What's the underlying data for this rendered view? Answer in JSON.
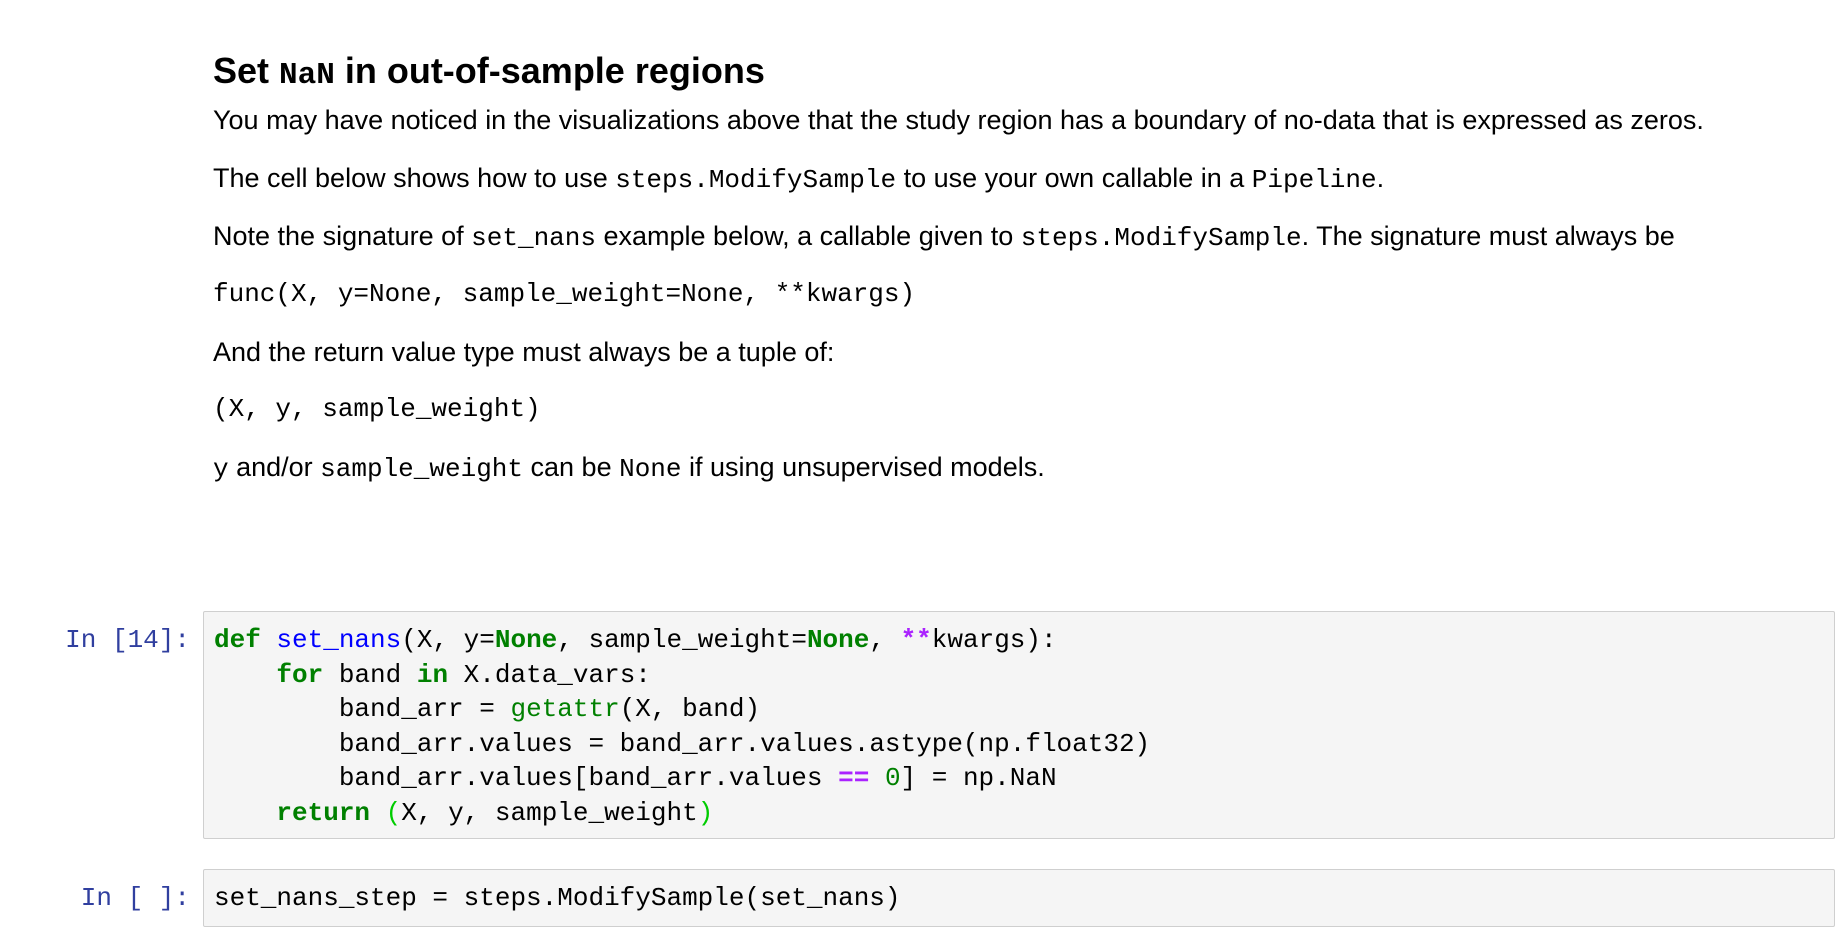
{
  "markdown": {
    "heading_pre": "Set ",
    "heading_code": "NaN",
    "heading_post": " in out-of-sample regions",
    "p1": "You may have noticed in the visualizations above that the study region has a boundary of no-data that is expressed as zeros.",
    "p2_a": "The cell below shows how to use ",
    "p2_code1": "steps.ModifySample",
    "p2_b": " to use your own callable in a ",
    "p2_code2": "Pipeline",
    "p2_c": ".",
    "p3_a": "Note the signature of ",
    "p3_code1": "set_nans",
    "p3_b": " example below, a callable given to ",
    "p3_code2": "steps.ModifySample",
    "p3_c": ". The signature must always be",
    "code_sig": "func(X, y=None, sample_weight=None, **kwargs)",
    "p4": "And the return value type must always be a tuple of:",
    "code_tuple": "(X, y, sample_weight)",
    "p5_code1": "y",
    "p5_a": " and/or ",
    "p5_code2": "sample_weight",
    "p5_b": " can be ",
    "p5_code3": "None",
    "p5_c": " if using unsupervised models."
  },
  "cells": [
    {
      "prompt": "In [14]:",
      "tokens": {
        "def": "def",
        "fname": "set_nans",
        "sig_a": "(X, y=",
        "none1": "None",
        "sig_b": ", sample_weight=",
        "none2": "None",
        "sig_c": ", ",
        "stars": "**",
        "sig_d": "kwargs):",
        "for": "for",
        "band": " band ",
        "in": "in",
        "datavars": " X.data_vars:",
        "l3_a": "band_arr = ",
        "getattr": "getattr",
        "l3_b": "(X, band)",
        "l4": "band_arr.values = band_arr.values.astype(np.float32)",
        "l5_a": "band_arr.values[band_arr.values ",
        "eqeq": "==",
        "l5_sp": " ",
        "zero": "0",
        "l5_b": "] = np.NaN",
        "return": "return",
        "ret_sp": " ",
        "lp": "(",
        "ret_body": "X, y, sample_weight",
        "rp": ")"
      }
    },
    {
      "prompt": "In [ ]:",
      "code": "set_nans_step = steps.ModifySample(set_nans)"
    }
  ],
  "colors": {
    "prompt": "#303f9f",
    "keyword": "#008000",
    "function_name": "#0000ff",
    "operator": "#aa22ff",
    "cell_background": "#f5f5f5",
    "cell_border": "#cfcfcf"
  }
}
